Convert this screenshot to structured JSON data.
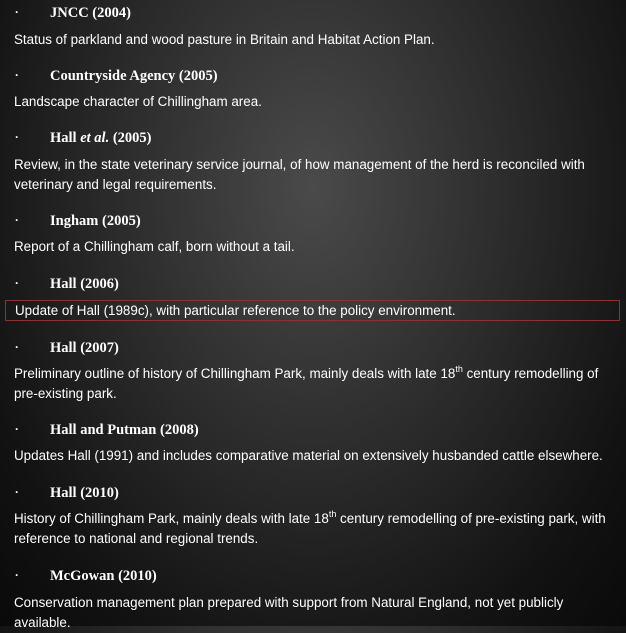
{
  "bullet": "·",
  "entries": [
    {
      "author": "JNCC",
      "year": "(2004)",
      "desc": "Status of parkland and wood pasture in Britain and Habitat Action Plan."
    },
    {
      "author": "Countryside Agency",
      "year": "(2005)",
      "desc": "Landscape character of Chillingham area."
    },
    {
      "author": "Hall",
      "etal": "et al.",
      "year": "(2005)",
      "desc": "Review, in the state veterinary service journal, of how management of the herd is reconciled with veterinary and legal requirements."
    },
    {
      "author": "Ingham",
      "year": "(2005)",
      "desc": "Report of a Chillingham calf, born without a tail."
    },
    {
      "author": "Hall",
      "year": "(2006)",
      "desc": "Update of Hall (1989c), with particular reference to the policy environment."
    },
    {
      "author": "Hall",
      "year": "(2007)",
      "desc_pre": "Preliminary outline of history of Chillingham Park, mainly deals with late 18",
      "desc_sup": "th",
      "desc_post": " century remodelling of pre-existing park."
    },
    {
      "author": "Hall and Putman",
      "year": "(2008)",
      "desc": "Updates Hall (1991) and includes comparative material on extensively husbanded cattle elsewhere."
    },
    {
      "author": "Hall",
      "year": "(2010)",
      "desc_pre": "History of Chillingham Park, mainly deals with late 18",
      "desc_sup": "th",
      "desc_post": " century remodelling of pre-existing park, with reference to national and regional trends."
    },
    {
      "author": "McGowan",
      "year": "(2010)",
      "desc": "Conservation management plan prepared with support from Natural England, not yet publicly available."
    }
  ]
}
